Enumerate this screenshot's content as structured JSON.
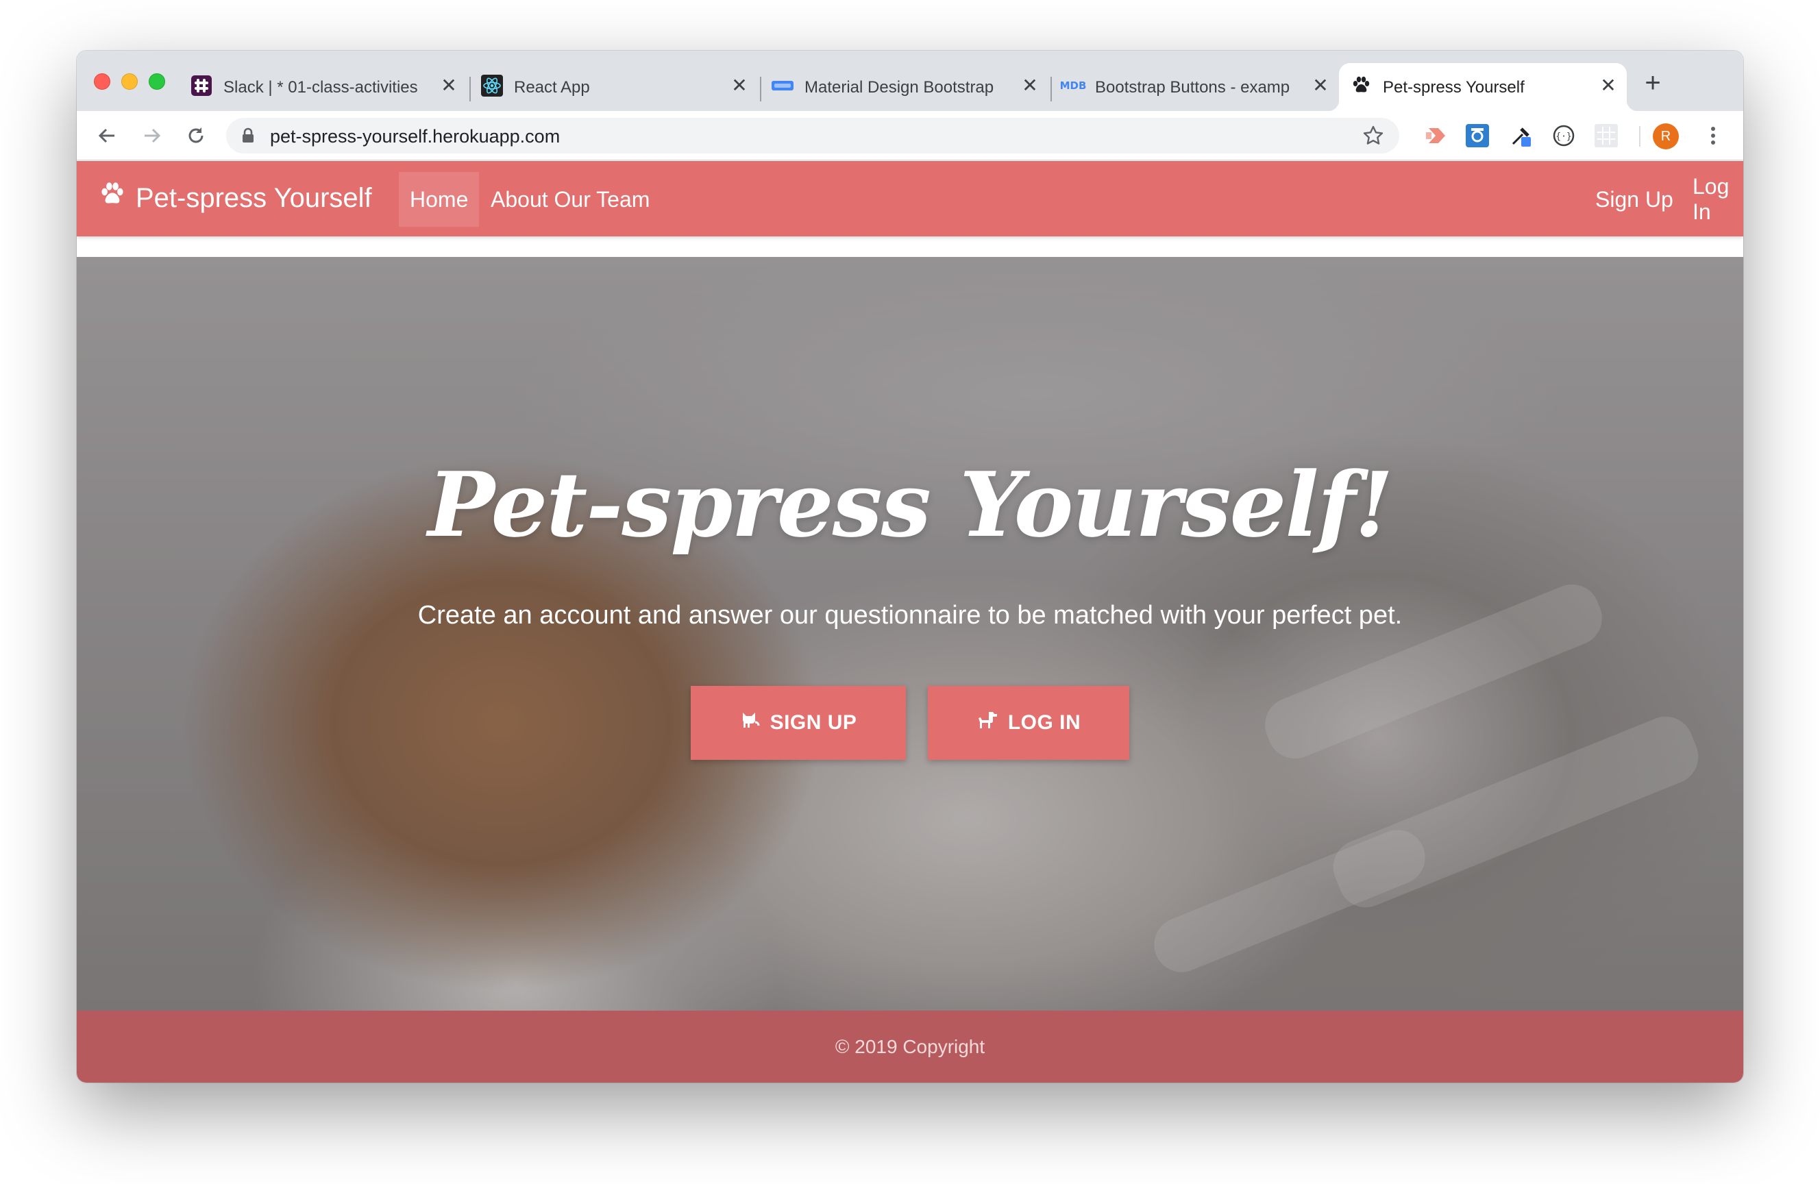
{
  "browser": {
    "tabs": [
      {
        "title": "Slack | * 01-class-activities",
        "icon": "slack-icon",
        "active": false
      },
      {
        "title": "React App",
        "icon": "react-icon",
        "active": false
      },
      {
        "title": "Material Design Bootstrap",
        "icon": "mdb-bar-icon",
        "active": false
      },
      {
        "title": "Bootstrap Buttons - examp",
        "icon": "mdb-logo-icon",
        "icon_text": "MDB",
        "active": false
      },
      {
        "title": "Pet-spress Yourself",
        "icon": "paw-icon",
        "active": true
      }
    ],
    "close_glyph": "✕",
    "new_tab_glyph": "+",
    "url": "pet-spress-yourself.herokuapp.com",
    "profile_initial": "R",
    "colors": {
      "profile": "#e8711a"
    }
  },
  "site": {
    "brand": "Pet-spress Yourself",
    "nav": [
      {
        "label": "Home",
        "active": true
      },
      {
        "label": "About Our Team",
        "active": false
      }
    ],
    "nav_right": [
      {
        "label": "Sign Up"
      },
      {
        "label": "Log In"
      }
    ],
    "hero": {
      "title": "Pet-spress Yourself!",
      "subtitle": "Create an account and answer our questionnaire to be matched with your perfect pet.",
      "signup_button": "SIGN UP",
      "login_button": "LOG IN"
    },
    "footer": "© 2019 Copyright",
    "colors": {
      "primary": "#e36e6e",
      "footer": "#b75a5e"
    }
  }
}
